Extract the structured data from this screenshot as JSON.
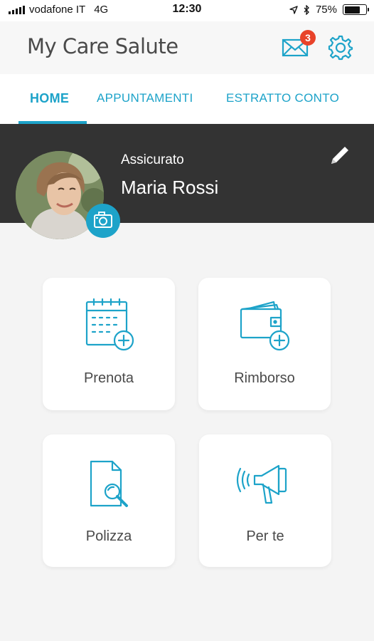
{
  "status_bar": {
    "carrier": "vodafone IT",
    "network": "4G",
    "time": "12:30",
    "battery": "75%",
    "battery_level": 0.75
  },
  "header": {
    "logo": "My Care Salute",
    "mail_badge_count": "3",
    "icons": [
      "mail-icon",
      "gear-icon"
    ]
  },
  "tabs": [
    {
      "label": "HOME",
      "active": true
    },
    {
      "label": "APPUNTAMENTI",
      "active": false
    },
    {
      "label": "ESTRATTO CONTO",
      "active": false
    }
  ],
  "profile": {
    "role": "Assicurato",
    "name": "Maria Rossi"
  },
  "cards": [
    {
      "label": "Prenota",
      "icon": "calendar-add-icon"
    },
    {
      "label": "Rimborso",
      "icon": "wallet-add-icon"
    },
    {
      "label": "Polizza",
      "icon": "document-search-icon"
    },
    {
      "label": "Per te",
      "icon": "megaphone-icon"
    }
  ],
  "colors": {
    "accent": "#1da3c9",
    "badge": "#e8432a",
    "profile_band": "#333333",
    "background": "#f4f4f4"
  }
}
